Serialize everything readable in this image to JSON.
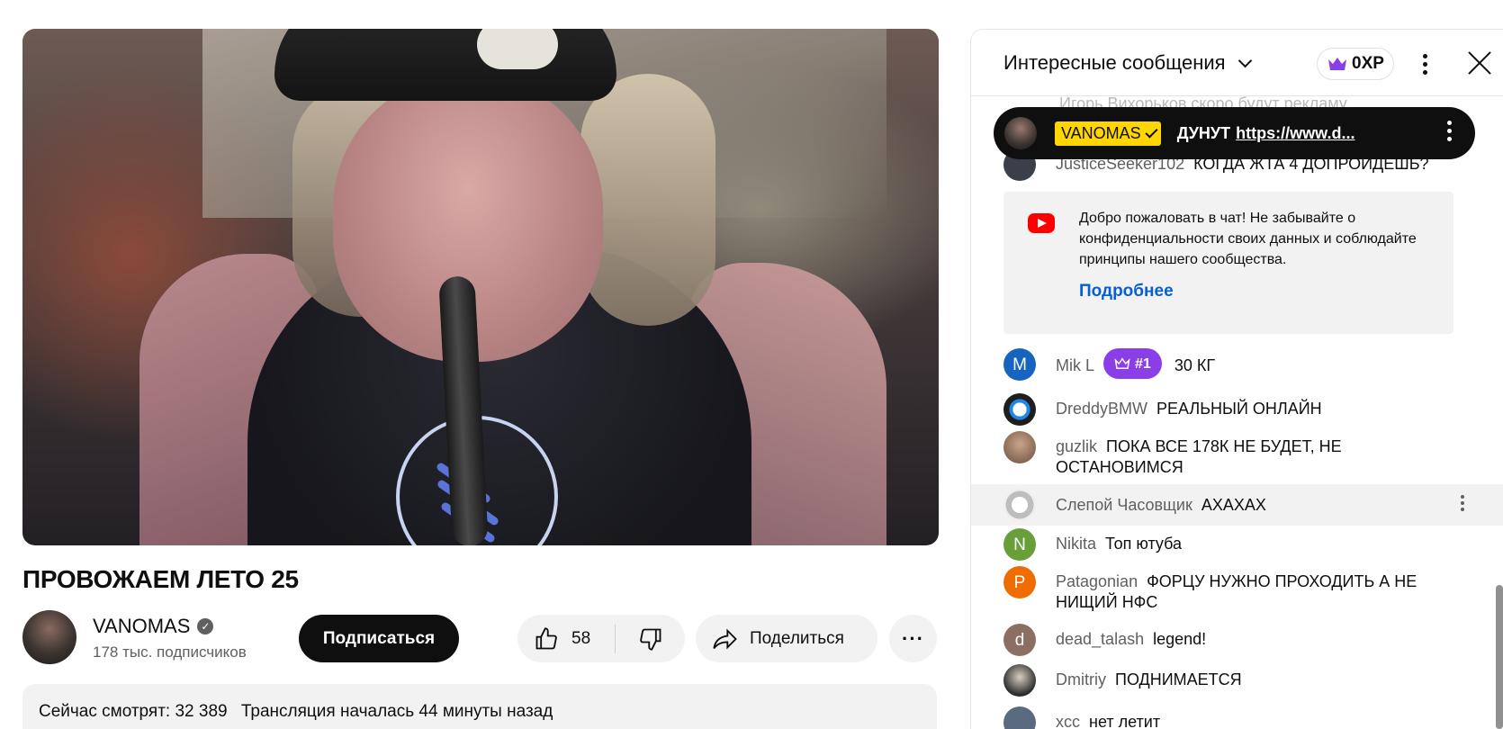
{
  "video": {
    "title": "ПРОВОЖАЕМ ЛЕТО 25",
    "channel": {
      "name": "VANOMAS",
      "subscribers": "178 тыс. подписчиков"
    },
    "subscribe_label": "Подписаться",
    "likes": "58",
    "share_label": "Поделиться",
    "more_label": "···",
    "watching_now": "Сейчас смотрят: 32 389",
    "stream_started": "Трансляция началась 44 минуты назад"
  },
  "chat": {
    "title": "Интересные сообщения",
    "xp": "0XP",
    "ghost_message": "Игорь Вихорьков  скоро будут рекламу",
    "pinned": {
      "author": "VANOMAS",
      "text": "ДУНУТ",
      "link": "https://www.d..."
    },
    "welcome": {
      "text": "Добро пожаловать в чат! Не забывайте о конфиденциальности своих данных и соблюдайте принципы нашего сообщества.",
      "link": "Подробнее"
    },
    "messages": [
      {
        "author": "JusticeSeeker102",
        "text": "КОГДА ЖТА 4 ДОПРОЙДЕШЬ?",
        "avatar_letter": "",
        "avatar_color": "#3a3f4a"
      },
      {
        "author": "Mik L",
        "rank": "#1",
        "text": "30 КГ",
        "avatar_letter": "M",
        "avatar_color": "#1565c0"
      },
      {
        "author": "DreddyBMW",
        "text": "РЕАЛЬНЫЙ ОНЛАЙН",
        "avatar_letter": "",
        "avatar_color": "#1e1e1e"
      },
      {
        "author": "guzlik",
        "text": "ПОКА ВСЕ 178К НЕ БУДЕТ, НЕ ОСТАНОВИМСЯ",
        "avatar_letter": "",
        "avatar_color": "#8a6a55"
      },
      {
        "author": "Слепой Часовщик",
        "text": "АХАХАХ",
        "avatar_letter": "",
        "avatar_color": "#d9d9d9"
      },
      {
        "author": "Nikita",
        "text": "Топ ютуба",
        "avatar_letter": "N",
        "avatar_color": "#689f38"
      },
      {
        "author": "Patagonian",
        "text": "ФОРЦУ НУЖНО ПРОХОДИТЬ А НЕ НИЩИЙ НФС",
        "avatar_letter": "P",
        "avatar_color": "#ef6c00"
      },
      {
        "author": "dead_talash",
        "text": "legend!",
        "avatar_letter": "d",
        "avatar_color": "#8d6e63"
      },
      {
        "author": "Dmitriy",
        "text": "ПОДНИМАЕТСЯ",
        "avatar_letter": "",
        "avatar_color": "#2b2b2b"
      },
      {
        "author": "xcc",
        "text": "нет летит",
        "avatar_letter": "",
        "avatar_color": "#5a6a80"
      }
    ]
  }
}
